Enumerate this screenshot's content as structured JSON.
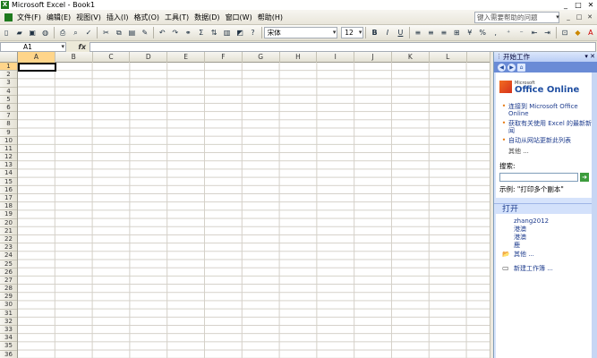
{
  "window": {
    "title": "Microsoft Excel - Book1",
    "app_icon": "X",
    "controls": [
      "_",
      "□",
      "✕"
    ]
  },
  "menu": {
    "items": [
      "文件(F)",
      "编辑(E)",
      "视图(V)",
      "插入(I)",
      "格式(O)",
      "工具(T)",
      "数据(D)",
      "窗口(W)",
      "帮助(H)"
    ],
    "ask_placeholder": "键入需要帮助的问题",
    "mdi_controls": [
      "▾",
      "_",
      "□",
      "✕"
    ]
  },
  "toolbar": {
    "font": "宋体",
    "size": "12",
    "zoom_icon": "Σ",
    "bold": "B",
    "italic": "I",
    "underline": "U",
    "percent": "%"
  },
  "formula_bar": {
    "name_box": "A1",
    "fx": "fx",
    "value": ""
  },
  "grid": {
    "columns": [
      "A",
      "B",
      "C",
      "D",
      "E",
      "F",
      "G",
      "H",
      "I",
      "J",
      "K",
      "L"
    ],
    "rows": [
      "1",
      "2",
      "3",
      "4",
      "5",
      "6",
      "7",
      "8",
      "9",
      "10",
      "11",
      "12",
      "13",
      "14",
      "15",
      "16",
      "17",
      "18",
      "19",
      "20",
      "21",
      "22",
      "23",
      "24",
      "25",
      "26",
      "27",
      "28",
      "29",
      "30",
      "31",
      "32",
      "33",
      "34",
      "35",
      "36"
    ],
    "active_cell": "A1"
  },
  "task_pane": {
    "title": "开始工作",
    "close": "▾ ✕",
    "logo_small": "Microsoft",
    "logo_main": "Office Online",
    "links": [
      "连接到 Microsoft Office Online",
      "获取有关使用 Excel 的最新新闻",
      "自动从网站更新此列表"
    ],
    "more": "其他 ...",
    "search_label": "搜索:",
    "search_value": "",
    "example": "示例: \"打印多个副本\"",
    "open_title": "打开",
    "files": [
      "zhang2012",
      "港澳",
      "港澳",
      "鹿"
    ],
    "open_more": "其他 ...",
    "new_workbook": "新建工作簿 ..."
  }
}
